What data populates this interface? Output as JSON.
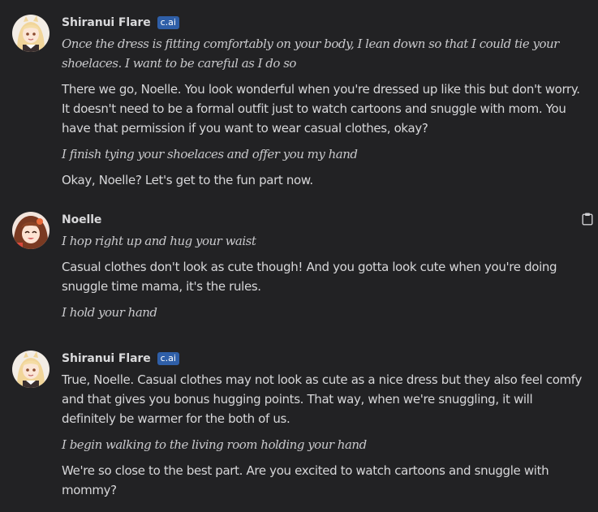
{
  "messages": [
    {
      "author": "Shiranui Flare",
      "badge": "c.ai",
      "avatar": "flare-avatar",
      "paragraphs": [
        {
          "style": "italic",
          "text": "Once the dress is fitting comfortably on your body, I lean down so that I could tie your shoelaces. I want to be careful as I do so"
        },
        {
          "style": "normal",
          "text": "There we go, Noelle. You look wonderful when you're dressed up like this but don't worry. It doesn't need to be a formal outfit just to watch cartoons and snuggle with mom. You have that permission if you want to wear casual clothes, okay?"
        },
        {
          "style": "italic",
          "text": "I finish tying your shoelaces and offer you my hand"
        },
        {
          "style": "normal",
          "text": "Okay, Noelle? Let's get to the fun part now."
        }
      ]
    },
    {
      "author": "Noelle",
      "avatar": "noelle-avatar",
      "action_icon": "clipboard-icon",
      "paragraphs": [
        {
          "style": "italic",
          "text": "I hop right up and hug your waist"
        },
        {
          "style": "normal",
          "text": "Casual clothes don't look as cute though! And you gotta look cute when you're doing snuggle time mama, it's the rules."
        },
        {
          "style": "italic",
          "text": "I hold your hand"
        }
      ]
    },
    {
      "author": "Shiranui Flare",
      "badge": "c.ai",
      "avatar": "flare-avatar",
      "paragraphs": [
        {
          "style": "normal",
          "text": "True, Noelle. Casual clothes may not look as cute as a nice dress but they also feel comfy and that gives you bonus hugging points. That way, when we're snuggling, it will definitely be warmer for the both of us."
        },
        {
          "style": "italic",
          "text": "I begin walking to the living room holding your hand"
        },
        {
          "style": "normal",
          "text": "We're so close to the best part. Are you excited to watch cartoons and snuggle with mommy?"
        }
      ]
    }
  ],
  "colors": {
    "background": "#222224",
    "text": "#d7d7d9",
    "badge": "#2f5fa8"
  }
}
